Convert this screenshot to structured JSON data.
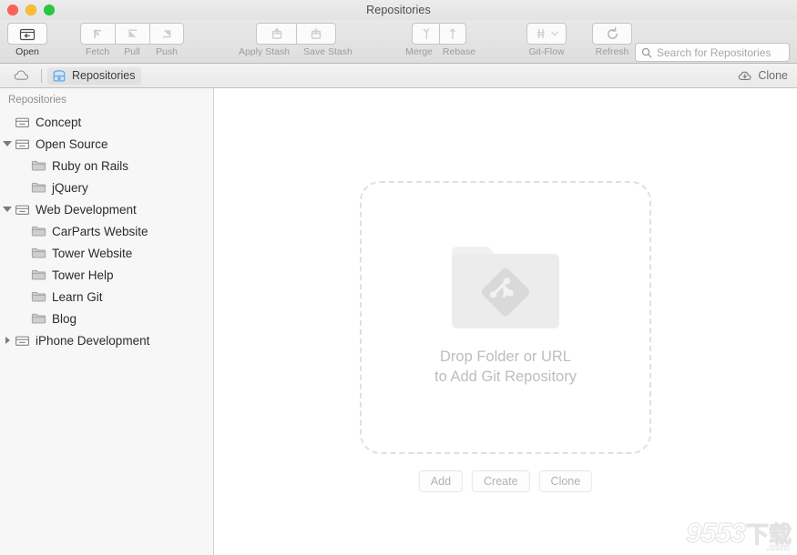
{
  "window": {
    "title": "Repositories",
    "traffic_lights": [
      {
        "name": "close",
        "color": "#ff5f57"
      },
      {
        "name": "minimize",
        "color": "#febc2e"
      },
      {
        "name": "maximize",
        "color": "#28c840"
      }
    ]
  },
  "toolbar": {
    "groups": [
      {
        "name": "open",
        "items": [
          {
            "label": "Open",
            "icon": "open-folder-icon",
            "enabled": true
          }
        ]
      },
      {
        "name": "sync",
        "items": [
          {
            "label": "Fetch",
            "icon": "fetch-arrow-icon",
            "enabled": false
          },
          {
            "label": "Pull",
            "icon": "pull-arrow-icon",
            "enabled": false
          },
          {
            "label": "Push",
            "icon": "push-arrow-icon",
            "enabled": false
          }
        ]
      },
      {
        "name": "stash",
        "items": [
          {
            "label": "Apply Stash",
            "icon": "apply-stash-icon",
            "enabled": false
          },
          {
            "label": "Save Stash",
            "icon": "save-stash-icon",
            "enabled": false
          }
        ]
      },
      {
        "name": "integrate",
        "items": [
          {
            "label": "Merge",
            "icon": "merge-icon",
            "enabled": false
          },
          {
            "label": "Rebase",
            "icon": "rebase-icon",
            "enabled": false
          }
        ]
      },
      {
        "name": "gitflow",
        "items": [
          {
            "label": "Git-Flow",
            "icon": "git-flow-icon",
            "enabled": false
          }
        ]
      },
      {
        "name": "refresh",
        "items": [
          {
            "label": "Refresh",
            "icon": "refresh-icon",
            "enabled": false
          }
        ]
      }
    ],
    "search": {
      "placeholder": "Search for Repositories",
      "value": "",
      "icon": "search-icon"
    }
  },
  "breadcrumb": {
    "home_icon": "cloud-icon",
    "current": {
      "label": "Repositories",
      "icon": "repository-drive-icon"
    },
    "clone": {
      "label": "Clone",
      "icon": "cloud-download-icon"
    }
  },
  "sidebar": {
    "header": "Repositories",
    "items": [
      {
        "label": "Concept",
        "icon": "repository-box-icon",
        "level": "top",
        "disclosure": "none"
      },
      {
        "label": "Open Source",
        "icon": "repository-box-icon",
        "level": "group",
        "disclosure": "expanded"
      },
      {
        "label": "Ruby on Rails",
        "icon": "folder-icon",
        "level": "child",
        "disclosure": "none"
      },
      {
        "label": "jQuery",
        "icon": "folder-icon",
        "level": "child",
        "disclosure": "none"
      },
      {
        "label": "Web Development",
        "icon": "repository-box-icon",
        "level": "group",
        "disclosure": "expanded"
      },
      {
        "label": "CarParts Website",
        "icon": "folder-icon",
        "level": "child",
        "disclosure": "none"
      },
      {
        "label": "Tower Website",
        "icon": "folder-icon",
        "level": "child",
        "disclosure": "none"
      },
      {
        "label": "Tower Help",
        "icon": "folder-icon",
        "level": "child",
        "disclosure": "none"
      },
      {
        "label": "Learn Git",
        "icon": "folder-icon",
        "level": "child",
        "disclosure": "none"
      },
      {
        "label": "Blog",
        "icon": "folder-icon",
        "level": "child",
        "disclosure": "none"
      },
      {
        "label": "iPhone Development",
        "icon": "repository-box-icon",
        "level": "group",
        "disclosure": "collapsed"
      }
    ]
  },
  "content": {
    "dropzone": {
      "icon": "git-folder-icon",
      "caption_line1": "Drop Folder or URL",
      "caption_line2": "to Add Git Repository"
    },
    "actions": [
      {
        "label": "Add"
      },
      {
        "label": "Create"
      },
      {
        "label": "Clone"
      }
    ]
  },
  "watermark": {
    "number": "9553",
    "chinese": "下载",
    "domain": ".com"
  },
  "colors": {
    "sidebar_bg": "#f7f7f7",
    "content_bg": "#ffffff",
    "toolbar_bg": "#e3e3e3",
    "accent_blue": "#6ea8dc",
    "disabled_text": "#9c9c9c",
    "dropzone_border": "#e0e0e0"
  }
}
